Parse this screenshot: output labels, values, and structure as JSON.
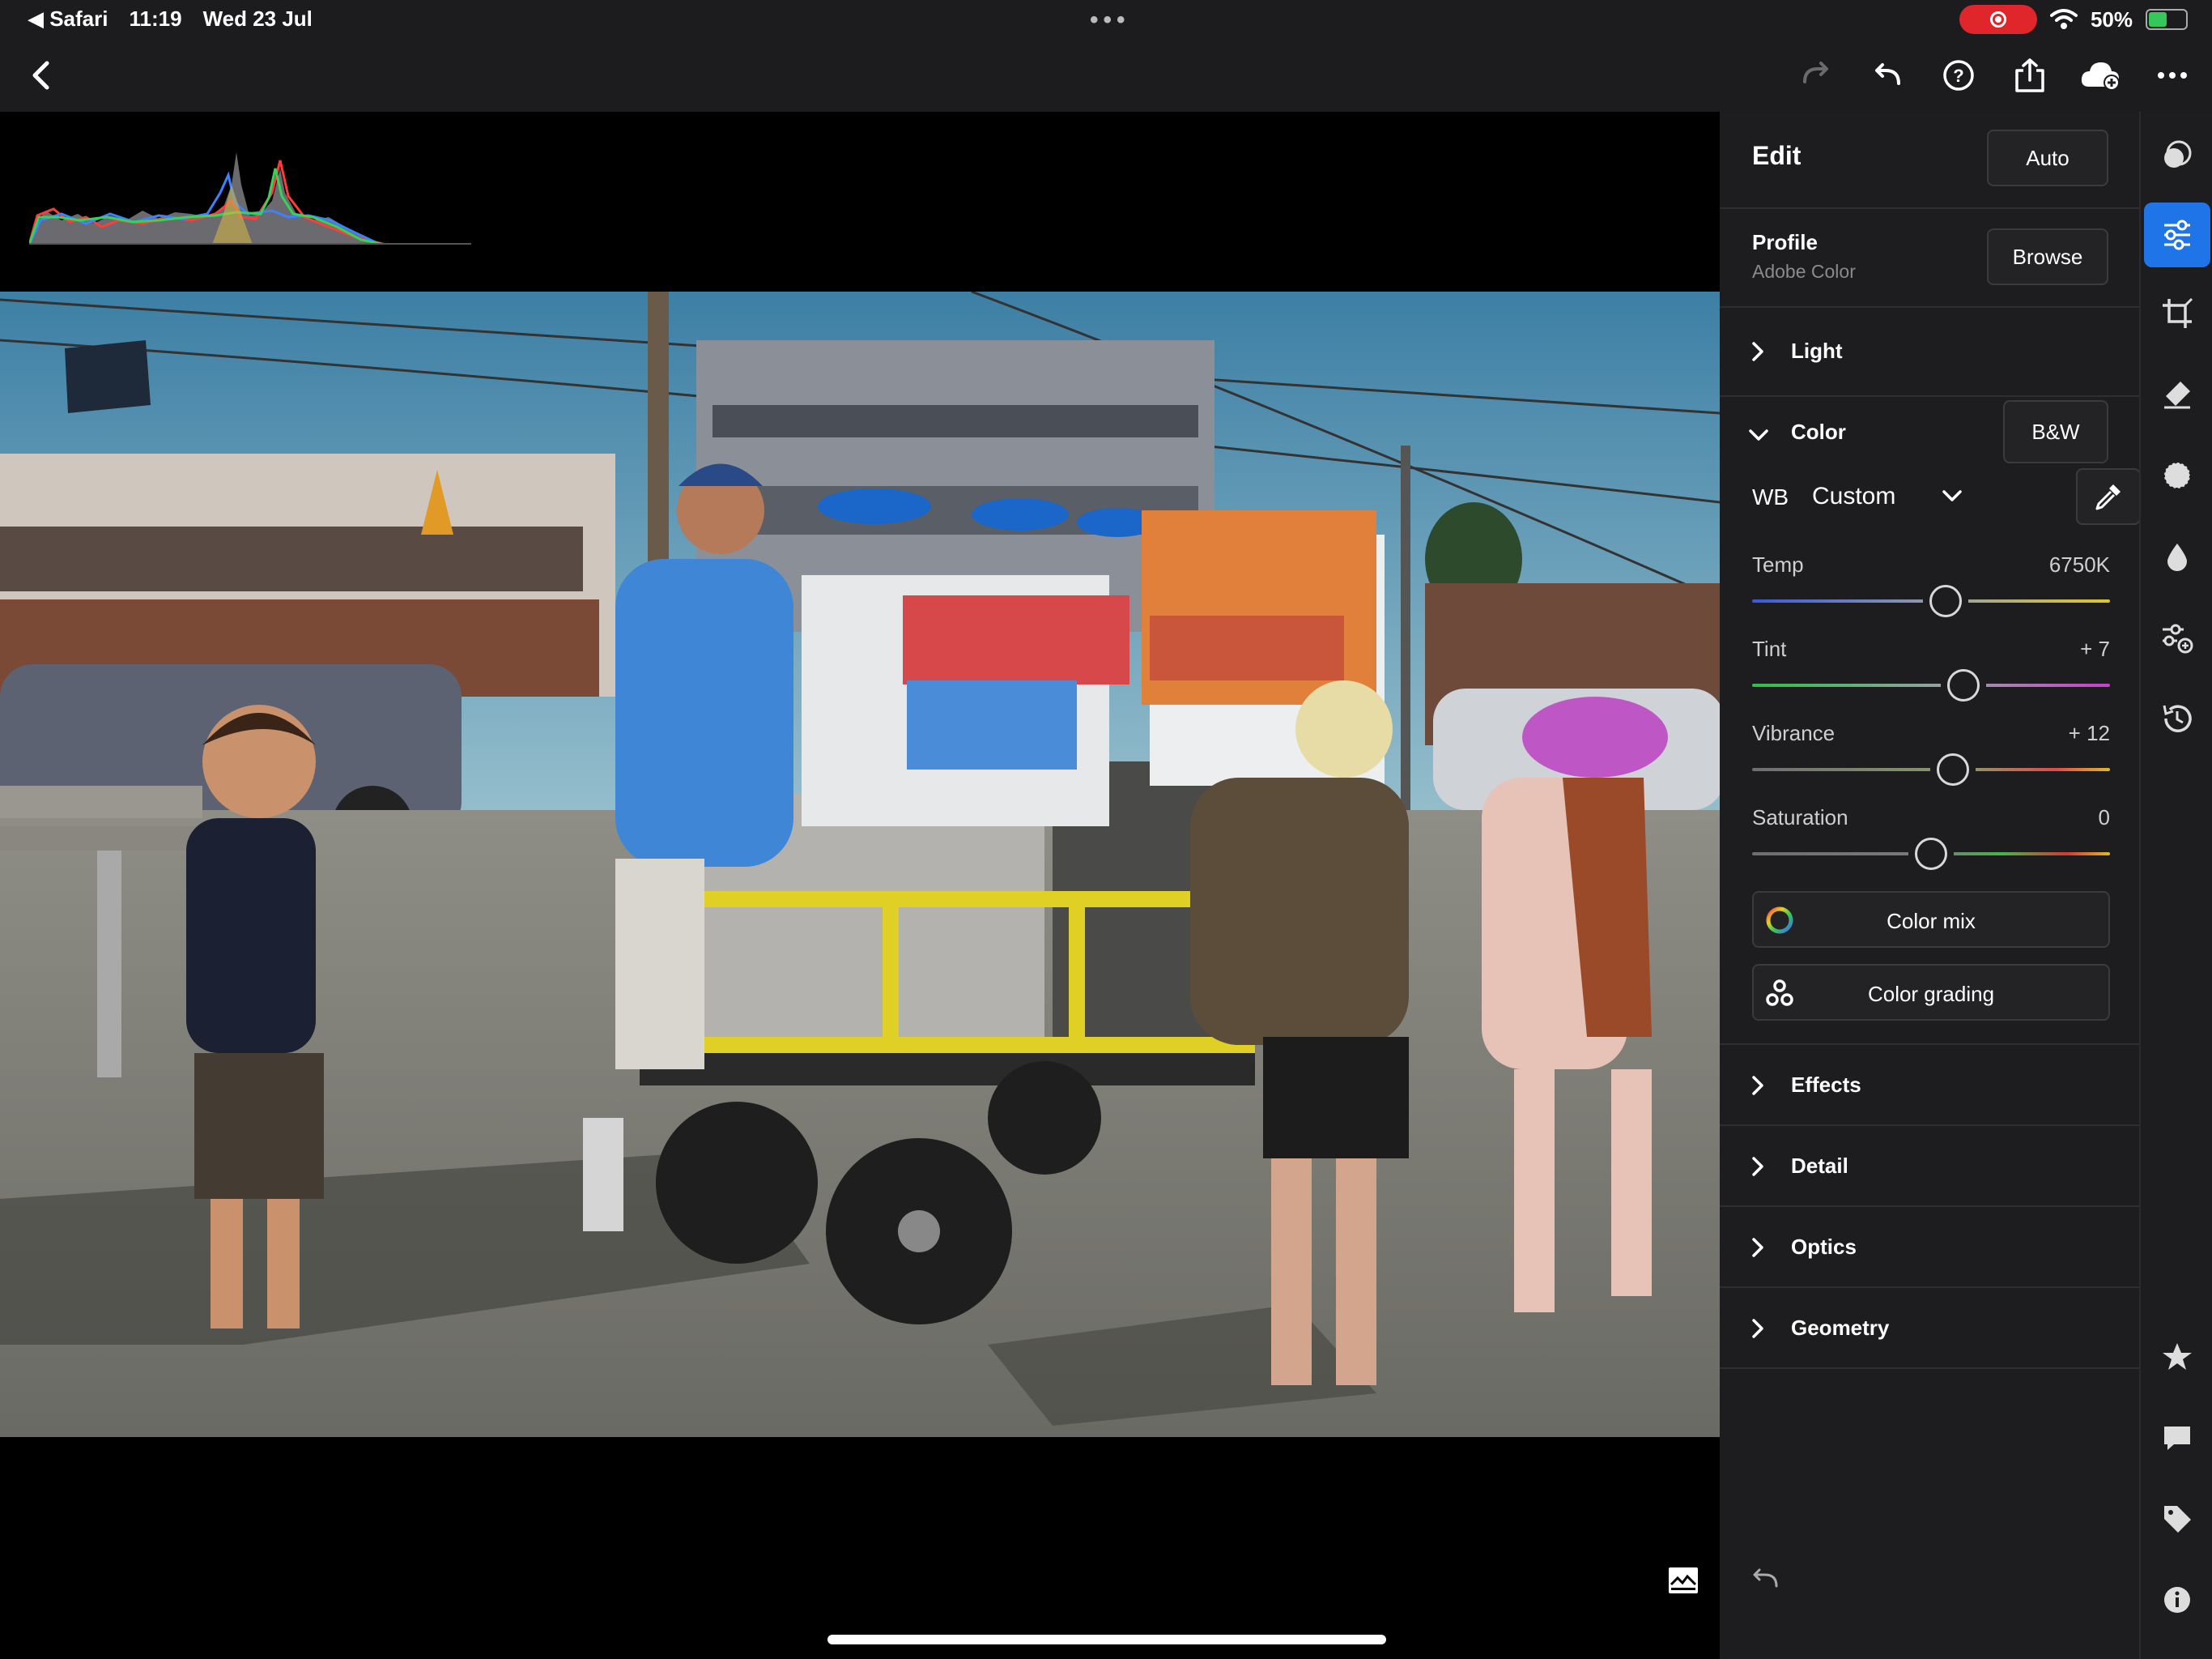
{
  "status_bar": {
    "back_app": "◀ Safari",
    "time": "11:19",
    "date": "Wed 23 Jul",
    "more": "•••",
    "battery_pct": "50%",
    "battery_level": 0.5,
    "recording_color": "#e0262b"
  },
  "toolbar": {
    "back_icon": "chevron-left-icon",
    "icons": [
      "redo-icon",
      "undo-icon",
      "help-icon",
      "share-icon",
      "cloud-upload-icon",
      "more-icon"
    ]
  },
  "panel": {
    "title": "Edit",
    "auto_label": "Auto",
    "profile": {
      "label": "Profile",
      "value": "Adobe Color",
      "browse_label": "Browse"
    },
    "sections_top": [
      {
        "label": "Light",
        "expanded": false
      }
    ],
    "color": {
      "label": "Color",
      "expanded": true,
      "bw_label": "B&W",
      "wb": {
        "label": "WB",
        "value": "Custom"
      },
      "sliders": [
        {
          "label": "Temp",
          "value": "6750K",
          "position": 0.54
        },
        {
          "label": "Tint",
          "value": "+ 7",
          "position": 0.59
        },
        {
          "label": "Vibrance",
          "value": "+ 12",
          "position": 0.56
        },
        {
          "label": "Saturation",
          "value": "0",
          "position": 0.5
        }
      ],
      "color_mix_label": "Color mix",
      "color_grading_label": "Color grading"
    },
    "sections_bottom": [
      {
        "label": "Effects"
      },
      {
        "label": "Detail"
      },
      {
        "label": "Optics"
      },
      {
        "label": "Geometry"
      }
    ]
  },
  "rail": {
    "active_index": 1,
    "accent": "#1f74e8",
    "icons": [
      "presets-icon",
      "edit-sliders-icon",
      "crop-icon",
      "healing-eraser-icon",
      "masking-icon",
      "versions-drop-icon",
      "adjust-plus-icon",
      "history-icon",
      "star-rating-icon",
      "comment-icon",
      "tag-icon",
      "info-icon"
    ]
  }
}
